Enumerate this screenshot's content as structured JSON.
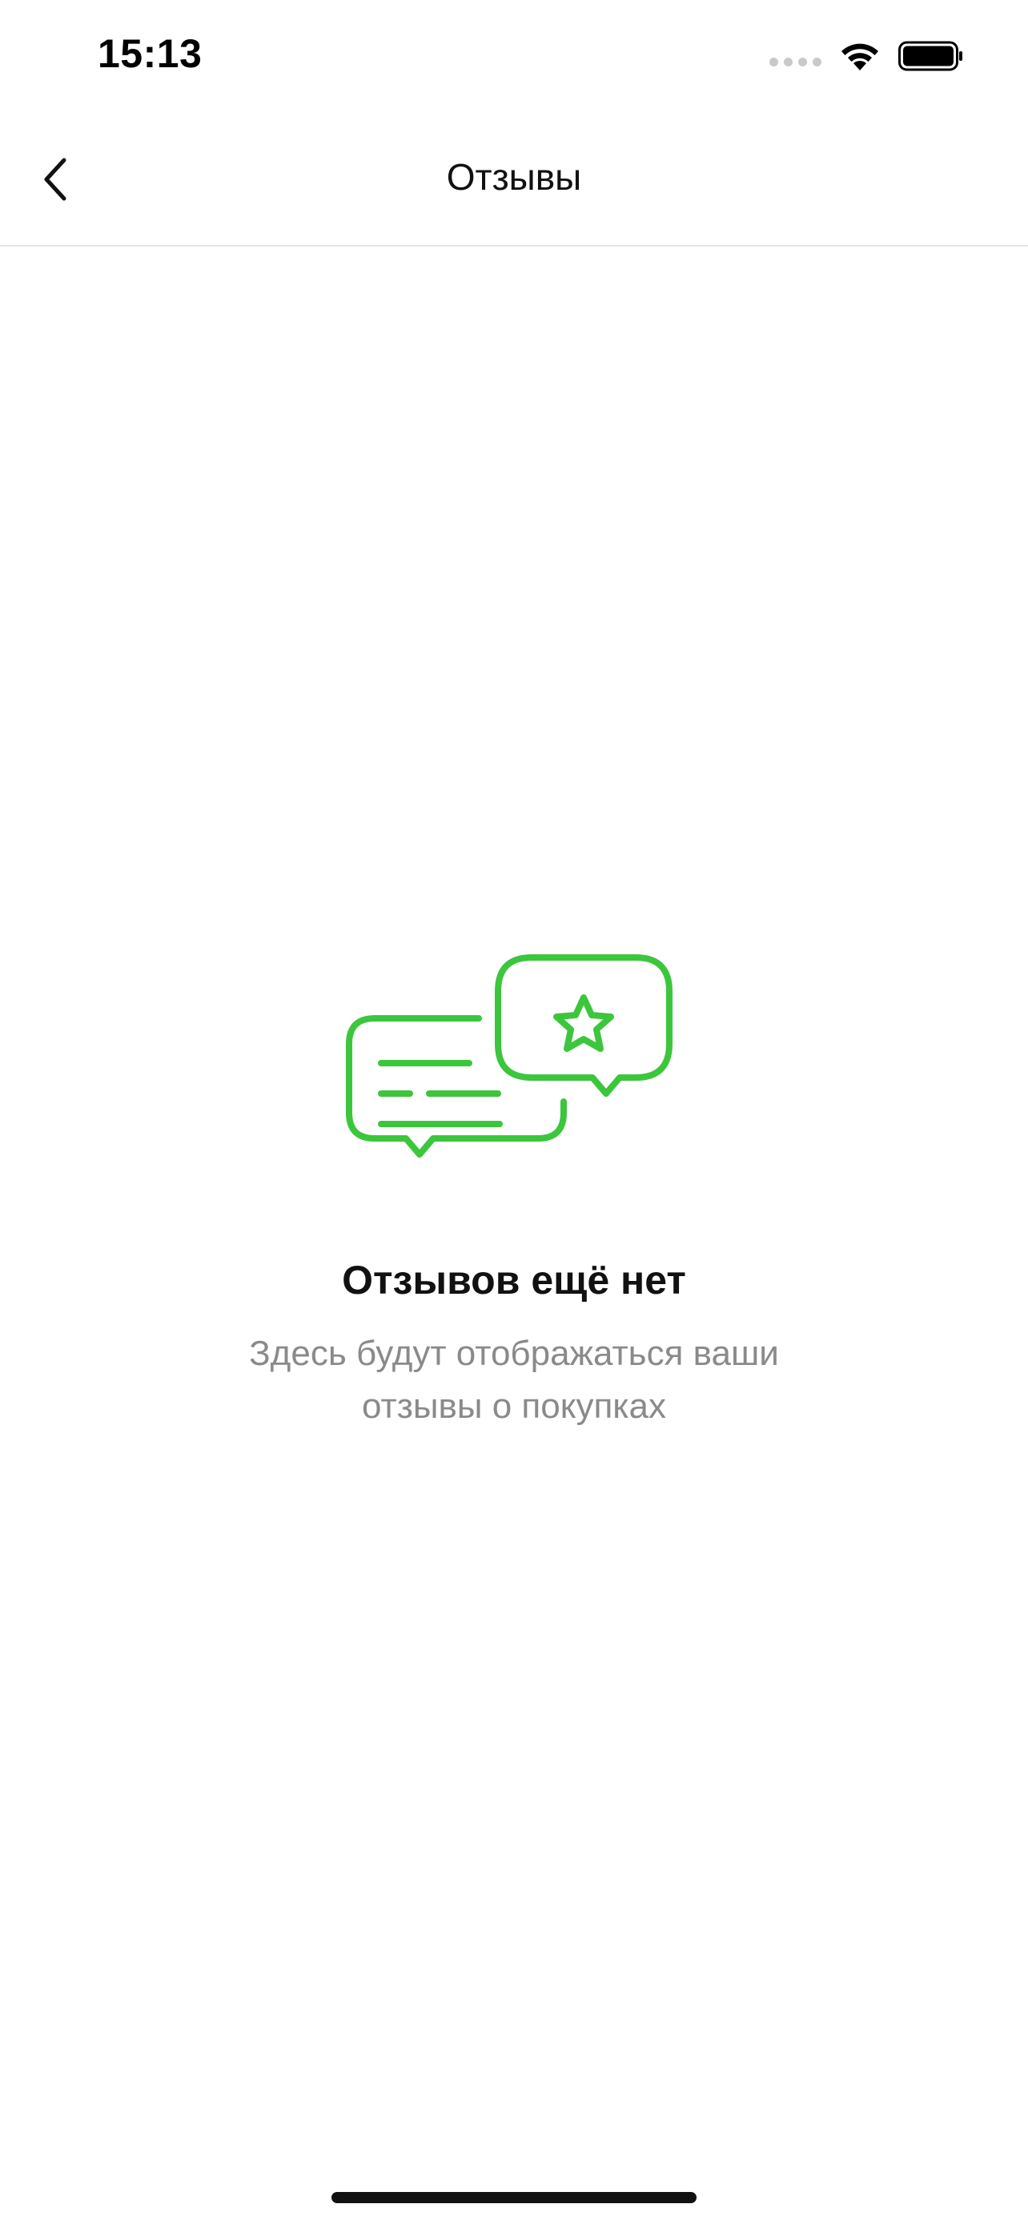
{
  "status_bar": {
    "time": "15:13",
    "icons": [
      "signal-icon",
      "wifi-icon",
      "battery-icon"
    ]
  },
  "nav": {
    "title": "Отзывы",
    "back_icon": "chevron-left-icon"
  },
  "empty_state": {
    "illustration_icon": "reviews-chat-star-icon",
    "title": "Отзывов ещё нет",
    "subtitle": "Здесь будут отображаться ваши отзывы о покупках"
  },
  "colors": {
    "accent": "#3cc63c",
    "text_primary": "#111111",
    "text_secondary": "#8a8a8a",
    "divider": "#e6e6e6"
  }
}
